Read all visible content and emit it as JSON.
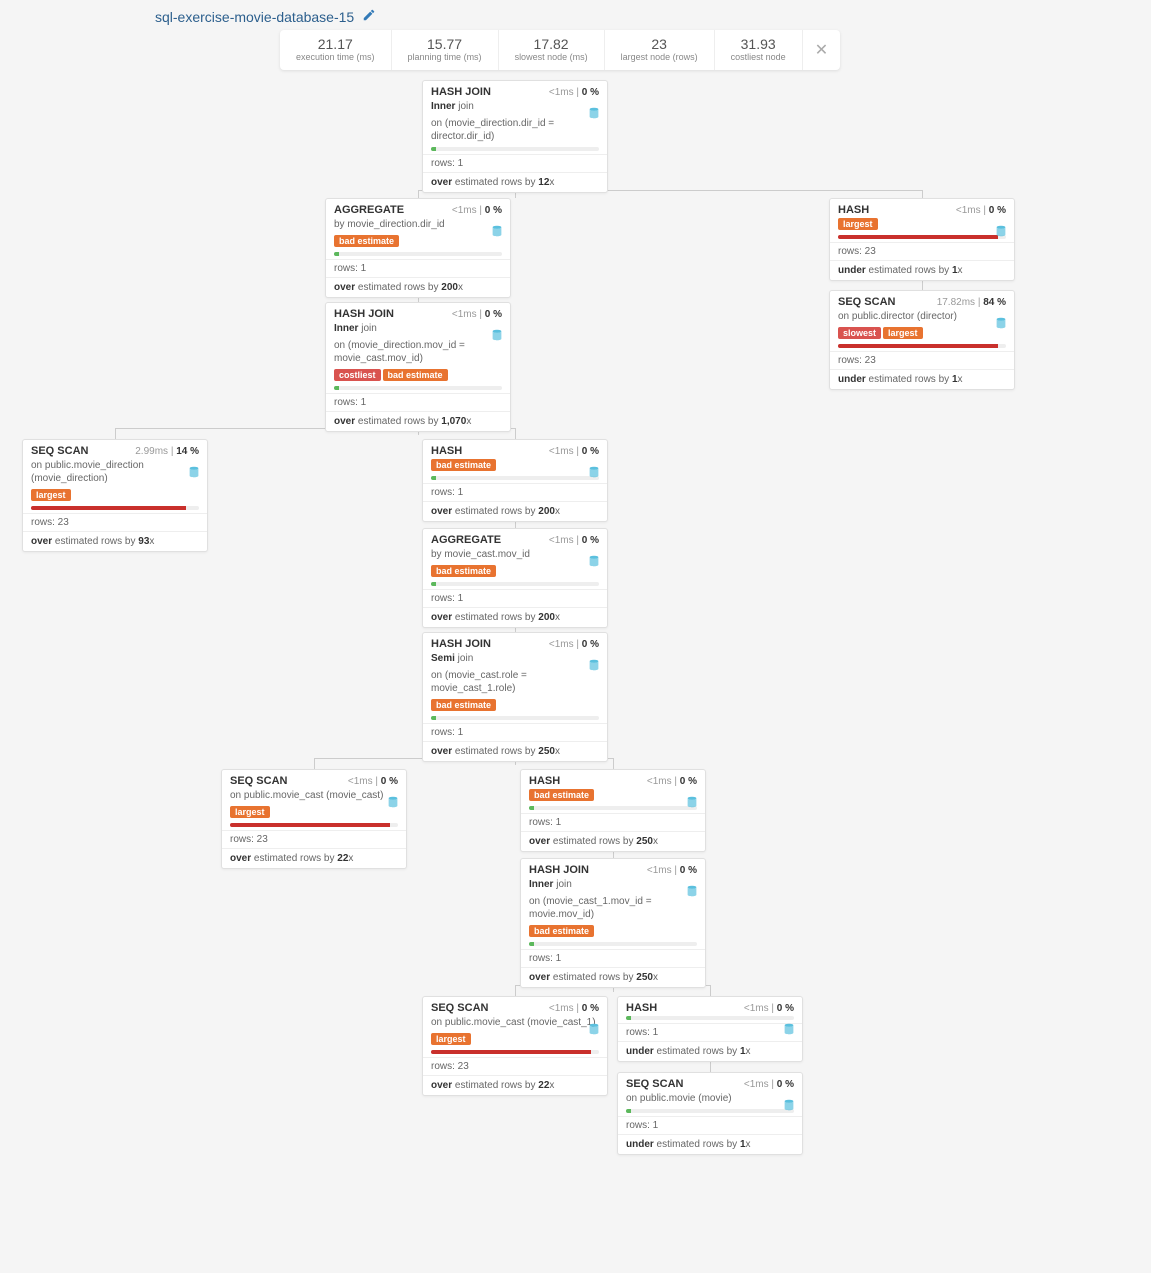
{
  "title": "sql-exercise-movie-database-15",
  "metrics": [
    {
      "value": "21.17",
      "label": "execution time (ms)"
    },
    {
      "value": "15.77",
      "label": "planning time (ms)"
    },
    {
      "value": "17.82",
      "label": "slowest node (ms)"
    },
    {
      "value": "23",
      "label": "largest node (rows)"
    },
    {
      "value": "31.93",
      "label": "costliest node"
    }
  ],
  "nodes": {
    "n1": {
      "title": "HASH JOIN",
      "time": "<1ms",
      "pct": "0 %",
      "sub_pre": "Inner",
      "sub_mid": " join",
      "sub2": "on (movie_direction.dir_id = director.dir_id)",
      "tags": [],
      "fill": "3",
      "barColor": "green",
      "rows": "rows: 1",
      "est_pre": "over",
      "est_mid": " estimated rows by ",
      "est_val": "12",
      "est_suf": "x"
    },
    "n2": {
      "title": "AGGREGATE",
      "time": "<1ms",
      "pct": "0 %",
      "sub": "by movie_direction.dir_id",
      "tags": [
        "bad estimate"
      ],
      "fill": "3",
      "barColor": "green",
      "rows": "rows: 1",
      "est_pre": "over",
      "est_mid": " estimated rows by ",
      "est_val": "200",
      "est_suf": "x"
    },
    "n3": {
      "title": "HASH",
      "time": "<1ms",
      "pct": "0 %",
      "tags": [
        "largest"
      ],
      "fill": "95",
      "barColor": "red",
      "rows": "rows: 23",
      "est_pre": "under",
      "est_mid": " estimated rows by ",
      "est_val": "1",
      "est_suf": "x"
    },
    "n4": {
      "title": "SEQ SCAN",
      "time": "17.82ms",
      "pct": "84 %",
      "sub": "on public.director (director)",
      "tags": [
        "slowest",
        "largest"
      ],
      "fill": "95",
      "barColor": "red",
      "rows": "rows: 23",
      "est_pre": "under",
      "est_mid": " estimated rows by ",
      "est_val": "1",
      "est_suf": "x"
    },
    "n5": {
      "title": "HASH JOIN",
      "time": "<1ms",
      "pct": "0 %",
      "sub_pre": "Inner",
      "sub_mid": " join",
      "sub2": "on (movie_direction.mov_id = movie_cast.mov_id)",
      "tags": [
        "costliest",
        "bad estimate"
      ],
      "fill": "3",
      "barColor": "green",
      "rows": "rows: 1",
      "est_pre": "over",
      "est_mid": " estimated rows by ",
      "est_val": "1,070",
      "est_suf": "x"
    },
    "n6": {
      "title": "SEQ SCAN",
      "time": "2.99ms",
      "pct": "14 %",
      "sub": "on public.movie_direction (movie_direction)",
      "tags": [
        "largest"
      ],
      "fill": "92",
      "barColor": "red",
      "rows": "rows: 23",
      "est_pre": "over",
      "est_mid": " estimated rows by ",
      "est_val": "93",
      "est_suf": "x"
    },
    "n7": {
      "title": "HASH",
      "time": "<1ms",
      "pct": "0 %",
      "tags": [
        "bad estimate"
      ],
      "fill": "3",
      "barColor": "green",
      "rows": "rows: 1",
      "est_pre": "over",
      "est_mid": " estimated rows by ",
      "est_val": "200",
      "est_suf": "x"
    },
    "n8": {
      "title": "AGGREGATE",
      "time": "<1ms",
      "pct": "0 %",
      "sub": "by movie_cast.mov_id",
      "tags": [
        "bad estimate"
      ],
      "fill": "3",
      "barColor": "green",
      "rows": "rows: 1",
      "est_pre": "over",
      "est_mid": " estimated rows by ",
      "est_val": "200",
      "est_suf": "x"
    },
    "n9": {
      "title": "HASH JOIN",
      "time": "<1ms",
      "pct": "0 %",
      "sub_pre": "Semi",
      "sub_mid": " join",
      "sub2": "on (movie_cast.role = movie_cast_1.role)",
      "tags": [
        "bad estimate"
      ],
      "fill": "3",
      "barColor": "green",
      "rows": "rows: 1",
      "est_pre": "over",
      "est_mid": " estimated rows by ",
      "est_val": "250",
      "est_suf": "x"
    },
    "n10": {
      "title": "SEQ SCAN",
      "time": "<1ms",
      "pct": "0 %",
      "sub": "on public.movie_cast (movie_cast)",
      "tags": [
        "largest"
      ],
      "fill": "95",
      "barColor": "red",
      "rows": "rows: 23",
      "est_pre": "over",
      "est_mid": " estimated rows by ",
      "est_val": "22",
      "est_suf": "x"
    },
    "n11": {
      "title": "HASH",
      "time": "<1ms",
      "pct": "0 %",
      "tags": [
        "bad estimate"
      ],
      "fill": "3",
      "barColor": "green",
      "rows": "rows: 1",
      "est_pre": "over",
      "est_mid": " estimated rows by ",
      "est_val": "250",
      "est_suf": "x"
    },
    "n12": {
      "title": "HASH JOIN",
      "time": "<1ms",
      "pct": "0 %",
      "sub_pre": "Inner",
      "sub_mid": " join",
      "sub2": "on (movie_cast_1.mov_id = movie.mov_id)",
      "tags": [
        "bad estimate"
      ],
      "fill": "3",
      "barColor": "green",
      "rows": "rows: 1",
      "est_pre": "over",
      "est_mid": " estimated rows by ",
      "est_val": "250",
      "est_suf": "x"
    },
    "n13": {
      "title": "SEQ SCAN",
      "time": "<1ms",
      "pct": "0 %",
      "sub": "on public.movie_cast (movie_cast_1)",
      "tags": [
        "largest"
      ],
      "fill": "95",
      "barColor": "red",
      "rows": "rows: 23",
      "est_pre": "over",
      "est_mid": " estimated rows by ",
      "est_val": "22",
      "est_suf": "x"
    },
    "n14": {
      "title": "HASH",
      "time": "<1ms",
      "pct": "0 %",
      "tags": [],
      "fill": "3",
      "barColor": "green",
      "rows": "rows: 1",
      "est_pre": "under",
      "est_mid": " estimated rows by ",
      "est_val": "1",
      "est_suf": "x"
    },
    "n15": {
      "title": "SEQ SCAN",
      "time": "<1ms",
      "pct": "0 %",
      "sub": "on public.movie (movie)",
      "tags": [],
      "fill": "3",
      "barColor": "green",
      "rows": "rows: 1",
      "est_pre": "under",
      "est_mid": " estimated rows by ",
      "est_val": "1",
      "est_suf": "x"
    }
  }
}
